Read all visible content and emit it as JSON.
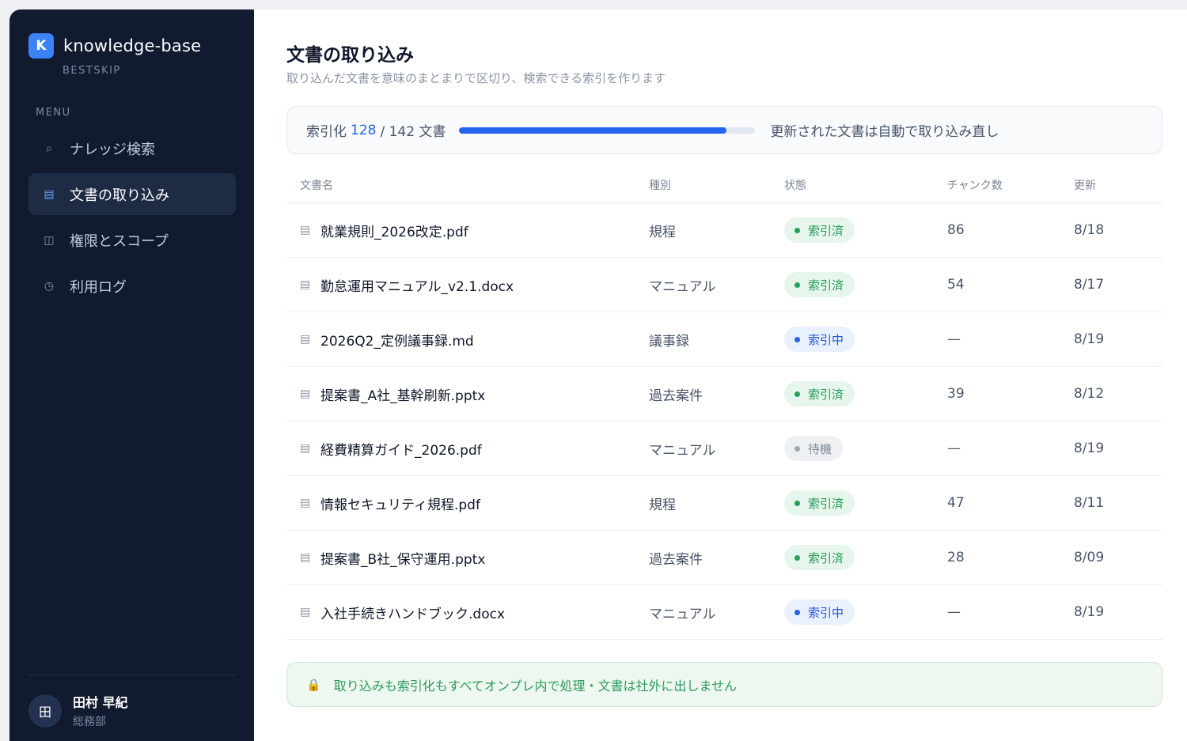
{
  "sidebar": {
    "brand_initial": "K",
    "brand_name": "knowledge-base",
    "brand_sub": "BESTSKIP",
    "menu_label": "MENU",
    "items": [
      {
        "icon": "⌕",
        "label": "ナレッジ検索",
        "icon_name": "search-icon"
      },
      {
        "icon": "▤",
        "label": "文書の取り込み",
        "icon_name": "document-icon",
        "active": true
      },
      {
        "icon": "◫",
        "label": "権限とスコープ",
        "icon_name": "scope-icon"
      },
      {
        "icon": "◷",
        "label": "利用ログ",
        "icon_name": "clock-icon"
      }
    ],
    "user": {
      "avatar": "田",
      "name": "田村 早紀",
      "dept": "総務部"
    }
  },
  "main": {
    "title": "文書の取り込み",
    "subtitle": "取り込んだ文書を意味のまとまりで区切り、検索できる索引を作ります",
    "progress": {
      "prefix": "索引化",
      "indexed": "128",
      "total": "/ 142 文書",
      "fraction": 0.9014,
      "note": "更新された文書は自動で取り込み直し"
    },
    "table": {
      "headers": [
        "文書名",
        "種別",
        "状態",
        "チャンク数",
        "更新"
      ],
      "rows": [
        {
          "name": "就業規則_2026改定.pdf",
          "type": "規程",
          "status": "索引済",
          "status_kind": "done",
          "chunks": "86",
          "date": "8/18"
        },
        {
          "name": "勤怠運用マニュアル_v2.1.docx",
          "type": "マニュアル",
          "status": "索引済",
          "status_kind": "done",
          "chunks": "54",
          "date": "8/17"
        },
        {
          "name": "2026Q2_定例議事録.md",
          "type": "議事録",
          "status": "索引中",
          "status_kind": "doing",
          "chunks": "—",
          "date": "8/19"
        },
        {
          "name": "提案書_A社_基幹刷新.pptx",
          "type": "過去案件",
          "status": "索引済",
          "status_kind": "done",
          "chunks": "39",
          "date": "8/12"
        },
        {
          "name": "経費精算ガイド_2026.pdf",
          "type": "マニュアル",
          "status": "待機",
          "status_kind": "wait",
          "chunks": "—",
          "date": "8/19"
        },
        {
          "name": "情報セキュリティ規程.pdf",
          "type": "規程",
          "status": "索引済",
          "status_kind": "done",
          "chunks": "47",
          "date": "8/11"
        },
        {
          "name": "提案書_B社_保守運用.pptx",
          "type": "過去案件",
          "status": "索引済",
          "status_kind": "done",
          "chunks": "28",
          "date": "8/09"
        },
        {
          "name": "入社手続きハンドブック.docx",
          "type": "マニュアル",
          "status": "索引中",
          "status_kind": "doing",
          "chunks": "—",
          "date": "8/19"
        }
      ]
    },
    "notice": {
      "icon": "🔒",
      "text": "取り込みも索引化もすべてオンプレ内で処理・文書は社外に出しません"
    }
  },
  "colors": {
    "sidebar_bg": "#111a2e",
    "accent": "#2563eb",
    "success": "#22a35c"
  }
}
